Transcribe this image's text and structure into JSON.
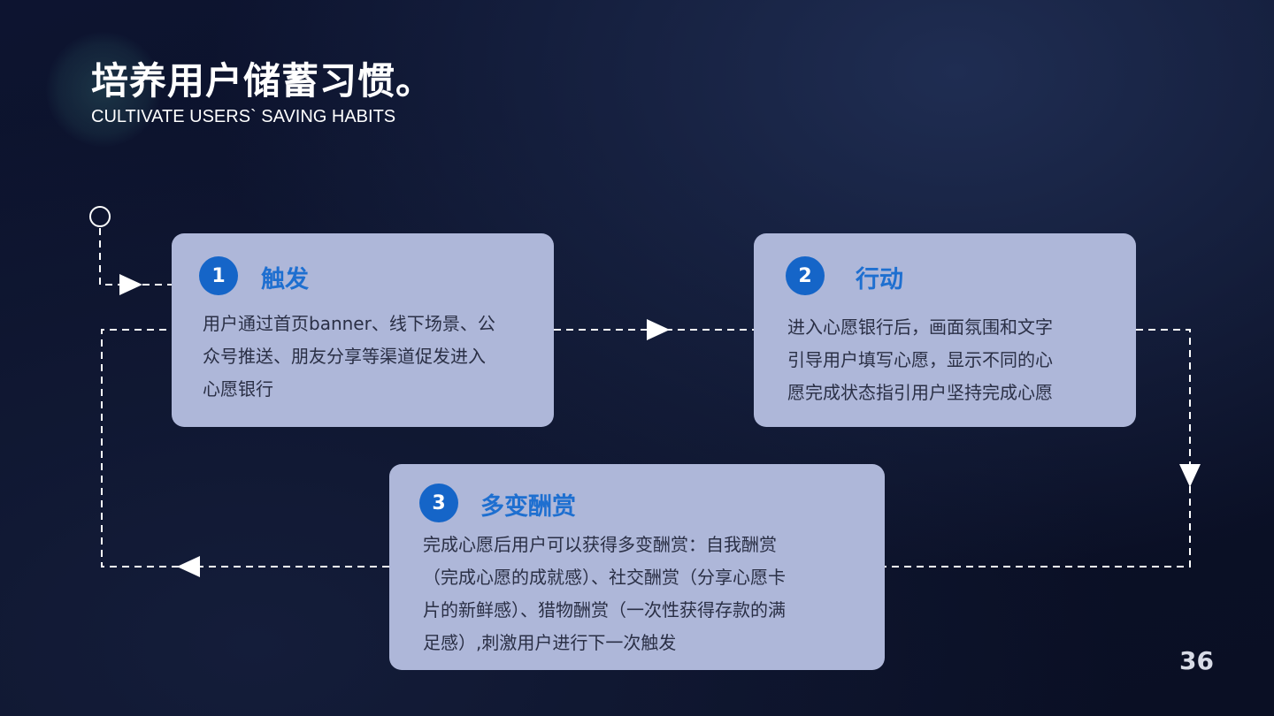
{
  "slide": {
    "title": "培养用户储蓄习惯。",
    "subtitle": "CULTIVATE USERS` SAVING HABITS",
    "page_number": "36"
  },
  "steps": [
    {
      "number": "1",
      "title": "触发",
      "text_lines": [
        "用户通过首页banner、线下场景、公",
        "众号推送、朋友分享等渠道促发进入",
        "心愿银行"
      ]
    },
    {
      "number": "2",
      "title": "行动",
      "text_lines": [
        "进入心愿银行后，画面氛围和文字",
        "引导用户填写心愿，显示不同的心",
        "愿完成状态指引用户坚持完成心愿"
      ]
    },
    {
      "number": "3",
      "title": "多变酬赏",
      "text_lines": [
        "完成心愿后用户可以获得多变酬赏：自我酬赏",
        "（完成心愿的成就感）、社交酬赏（分享心愿卡",
        "片的新鲜感）、猎物酬赏（一次性获得存款的满",
        "足感）,刺激用户进行下一次触发"
      ]
    }
  ],
  "colors": {
    "card_bg": "#aeb7d9",
    "badge": "#1565c8",
    "card_title": "#1e6fd0",
    "connector": "#ffffff"
  }
}
